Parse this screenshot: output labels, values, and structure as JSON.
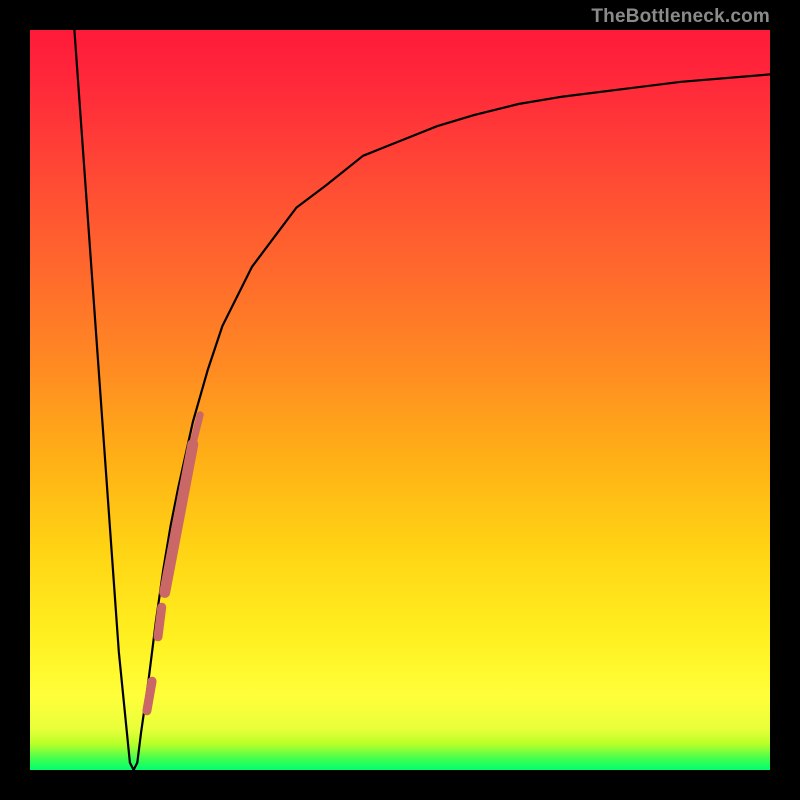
{
  "watermark": {
    "text": "TheBottleneck.com"
  },
  "colors": {
    "frame": "#000000",
    "curve": "#000000",
    "marker": "#ca6767",
    "green_band_top": "#9cff00",
    "green_band_bottom": "#00ff66",
    "gradient_stops": [
      {
        "offset": 0.0,
        "color": "#ff1a3a"
      },
      {
        "offset": 0.08,
        "color": "#ff2a3a"
      },
      {
        "offset": 0.2,
        "color": "#ff4a34"
      },
      {
        "offset": 0.33,
        "color": "#ff6a2c"
      },
      {
        "offset": 0.46,
        "color": "#ff8c22"
      },
      {
        "offset": 0.58,
        "color": "#ffb016"
      },
      {
        "offset": 0.7,
        "color": "#ffd314"
      },
      {
        "offset": 0.82,
        "color": "#fff020"
      },
      {
        "offset": 0.9,
        "color": "#ffff3a"
      },
      {
        "offset": 0.945,
        "color": "#e8ff3a"
      },
      {
        "offset": 0.965,
        "color": "#b8ff28"
      },
      {
        "offset": 0.985,
        "color": "#40ff50"
      },
      {
        "offset": 1.0,
        "color": "#00ff70"
      }
    ]
  },
  "chart_data": {
    "type": "line",
    "title": "",
    "xlabel": "",
    "ylabel": "",
    "xlim": [
      0,
      100
    ],
    "ylim": [
      0,
      100
    ],
    "series": [
      {
        "name": "bottleneck-curve",
        "x": [
          6,
          8,
          10,
          11,
          12,
          13,
          13.5,
          14,
          14.5,
          15,
          16,
          17,
          18,
          19,
          20,
          22,
          24,
          26,
          28,
          30,
          33,
          36,
          40,
          45,
          50,
          55,
          60,
          66,
          72,
          80,
          88,
          100
        ],
        "y": [
          100,
          72,
          44,
          30,
          16,
          6,
          1,
          0,
          1,
          5,
          12,
          20,
          27,
          33,
          38,
          47,
          54,
          60,
          64,
          68,
          72,
          76,
          79,
          83,
          85,
          87,
          88.5,
          90,
          91,
          92,
          93,
          94
        ]
      }
    ],
    "zero_bottleneck_x": 14,
    "markers": [
      {
        "name": "marker-segment-0",
        "x0": 15.8,
        "y0": 8,
        "x1": 16.5,
        "y1": 12,
        "width": 9
      },
      {
        "name": "marker-dot-1",
        "x0": 17.3,
        "y0": 18,
        "x1": 17.8,
        "y1": 22,
        "width": 9
      },
      {
        "name": "marker-segment-2",
        "x0": 18.2,
        "y0": 24,
        "x1": 22.0,
        "y1": 44,
        "width": 11
      },
      {
        "name": "marker-segment-3",
        "x0": 22.0,
        "y0": 44,
        "x1": 23.0,
        "y1": 48,
        "width": 7
      }
    ]
  }
}
